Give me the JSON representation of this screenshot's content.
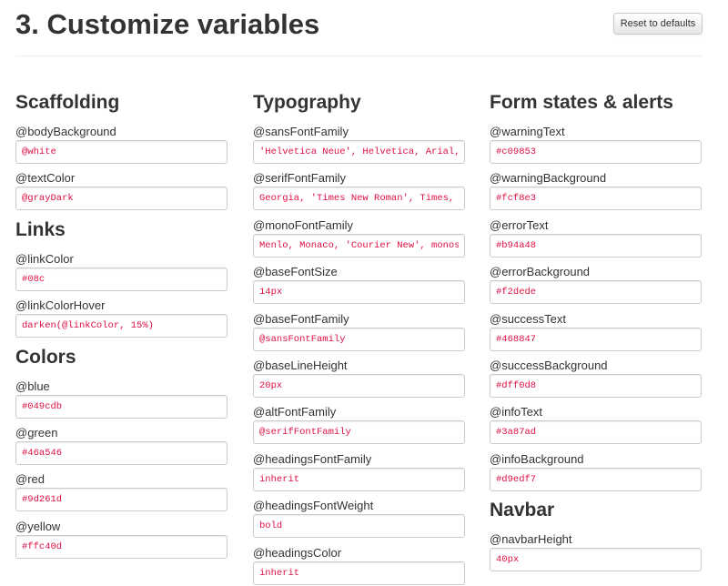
{
  "header": {
    "title": "3. Customize variables",
    "reset_label": "Reset to defaults"
  },
  "columns": [
    {
      "sections": [
        {
          "id": "scaffolding",
          "title": "Scaffolding",
          "fields": [
            {
              "label": "@bodyBackground",
              "value": "@white"
            },
            {
              "label": "@textColor",
              "value": "@grayDark"
            }
          ]
        },
        {
          "id": "links",
          "title": "Links",
          "fields": [
            {
              "label": "@linkColor",
              "value": "#08c"
            },
            {
              "label": "@linkColorHover",
              "value": "darken(@linkColor, 15%)"
            }
          ]
        },
        {
          "id": "colors",
          "title": "Colors",
          "fields": [
            {
              "label": "@blue",
              "value": "#049cdb"
            },
            {
              "label": "@green",
              "value": "#46a546"
            },
            {
              "label": "@red",
              "value": "#9d261d"
            },
            {
              "label": "@yellow",
              "value": "#ffc40d"
            }
          ]
        }
      ]
    },
    {
      "sections": [
        {
          "id": "typography",
          "title": "Typography",
          "fields": [
            {
              "label": "@sansFontFamily",
              "value": "'Helvetica Neue', Helvetica, Arial, sans-serif"
            },
            {
              "label": "@serifFontFamily",
              "value": "Georgia, 'Times New Roman', Times, serif"
            },
            {
              "label": "@monoFontFamily",
              "value": "Menlo, Monaco, 'Courier New', monospace"
            },
            {
              "label": "@baseFontSize",
              "value": "14px"
            },
            {
              "label": "@baseFontFamily",
              "value": "@sansFontFamily"
            },
            {
              "label": "@baseLineHeight",
              "value": "20px"
            },
            {
              "label": "@altFontFamily",
              "value": "@serifFontFamily"
            },
            {
              "label": "@headingsFontFamily",
              "value": "inherit"
            },
            {
              "label": "@headingsFontWeight",
              "value": "bold"
            },
            {
              "label": "@headingsColor",
              "value": "inherit"
            }
          ]
        }
      ]
    },
    {
      "sections": [
        {
          "id": "form-states-alerts",
          "title": "Form states & alerts",
          "fields": [
            {
              "label": "@warningText",
              "value": "#c09853"
            },
            {
              "label": "@warningBackground",
              "value": "#fcf8e3"
            },
            {
              "label": "@errorText",
              "value": "#b94a48"
            },
            {
              "label": "@errorBackground",
              "value": "#f2dede"
            },
            {
              "label": "@successText",
              "value": "#468847"
            },
            {
              "label": "@successBackground",
              "value": "#dff0d8"
            },
            {
              "label": "@infoText",
              "value": "#3a87ad"
            },
            {
              "label": "@infoBackground",
              "value": "#d9edf7"
            }
          ]
        },
        {
          "id": "navbar",
          "title": "Navbar",
          "fields": [
            {
              "label": "@navbarHeight",
              "value": "40px"
            }
          ]
        }
      ]
    }
  ]
}
